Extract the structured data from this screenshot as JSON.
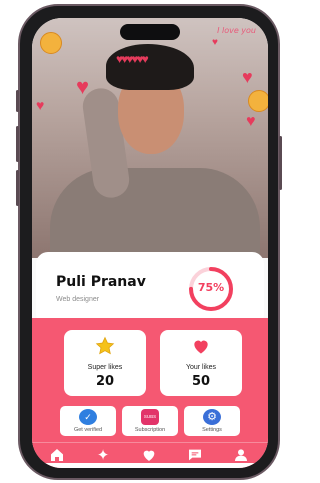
{
  "photo": {
    "overlay_text": "I love you"
  },
  "profile": {
    "name": "Puli Pranav",
    "role": "Web designer",
    "progress_percent": 75,
    "progress_label": "75%"
  },
  "stats": [
    {
      "icon": "star-icon",
      "label": "Super likes",
      "value": "20"
    },
    {
      "icon": "heart-icon",
      "label": "Your likes",
      "value": "50"
    }
  ],
  "actions": [
    {
      "icon": "verified-badge-icon",
      "label": "Get verified"
    },
    {
      "icon": "subscription-icon",
      "label": "Subscription",
      "badge": "SUBS"
    },
    {
      "icon": "gear-icon",
      "label": "Settings"
    }
  ],
  "nav": [
    {
      "icon": "home-icon"
    },
    {
      "icon": "sparkle-icon"
    },
    {
      "icon": "heart-icon"
    },
    {
      "icon": "chat-icon"
    },
    {
      "icon": "profile-icon"
    }
  ],
  "colors": {
    "accent": "#f55872",
    "progress": "#f2405f",
    "star": "#f5c21b",
    "verified": "#2f7fe0"
  }
}
